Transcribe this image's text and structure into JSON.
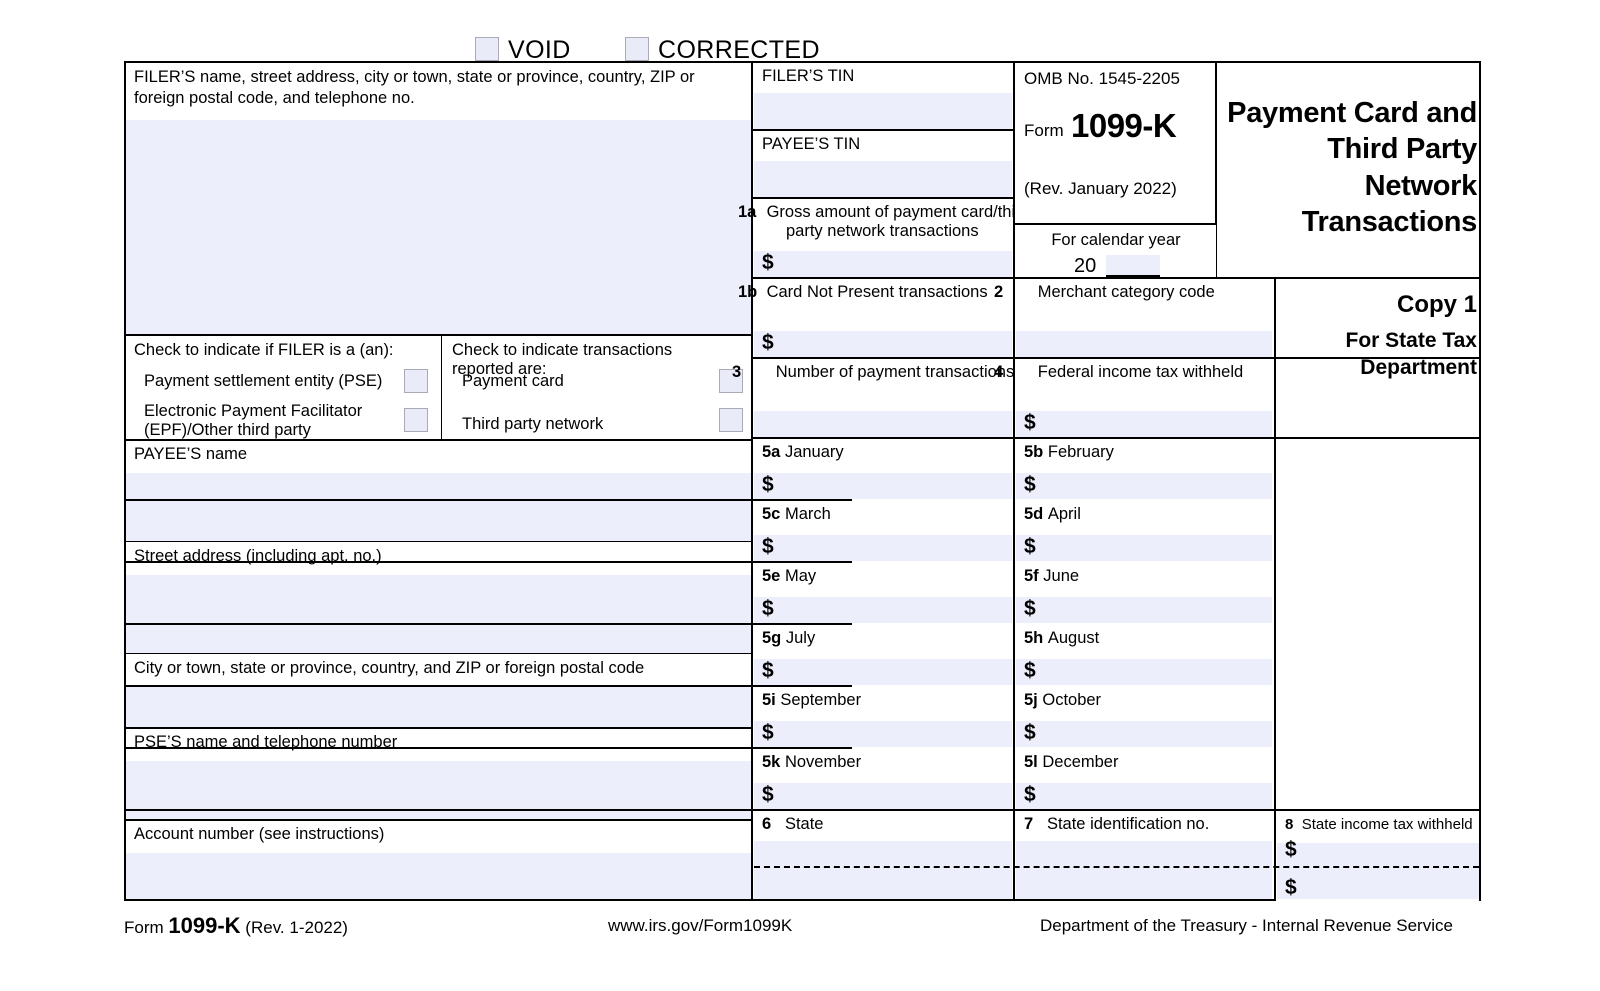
{
  "top_checkboxes": [
    {
      "name": "void",
      "label": "VOID",
      "checked": false
    },
    {
      "name": "corrected",
      "label": "CORRECTED",
      "checked": false
    }
  ],
  "filer": {
    "address_caption": "FILER’S name, street address, city or town, state or province, country, ZIP or foreign postal code, and telephone no.",
    "tin_caption": "FILER’S TIN",
    "tin_value": ""
  },
  "payee": {
    "tin_caption": "PAYEE’S TIN",
    "tin_value": "",
    "name_caption": "PAYEE’S name",
    "name_value": "",
    "street_caption": "Street address (including apt. no.)",
    "street_value": "",
    "city_caption": "City or town, state or province, country, and ZIP or foreign postal code",
    "city_value": ""
  },
  "pse": {
    "caption": "PSE’S name and telephone number",
    "value": ""
  },
  "account": {
    "caption": "Account number (see instructions)",
    "value": ""
  },
  "omb": {
    "number_label": "OMB No. 1545-2205",
    "form_word": "Form",
    "form_number": "1099-K",
    "revision": "(Rev. January 2022)",
    "calendar_year_label": "For calendar year",
    "year_prefix": "20",
    "year_value": ""
  },
  "title": {
    "line1": "Payment Card and",
    "line2": "Third Party",
    "line3": "Network",
    "line4": "Transactions"
  },
  "copy": {
    "line1": "Copy 1",
    "line2": "For State Tax",
    "line3": "Department"
  },
  "filer_type": {
    "heading": "Check to indicate if FILER is a (an):",
    "options": [
      {
        "label": "Payment settlement entity (PSE)",
        "checked": false
      },
      {
        "label": "Electronic Payment Facilitator (EPF)/Other third party",
        "checked": false
      }
    ]
  },
  "transaction_type": {
    "heading": "Check to indicate transactions reported are:",
    "options": [
      {
        "label": "Payment card",
        "checked": false
      },
      {
        "label": "Third party network",
        "checked": false
      }
    ]
  },
  "boxes": {
    "b1a": {
      "num": "1a",
      "label": "Gross amount of payment card/third party network transactions",
      "dollar": "$",
      "value": ""
    },
    "b1b": {
      "num": "1b",
      "label": "Card Not Present transactions",
      "dollar": "$",
      "value": ""
    },
    "b2": {
      "num": "2",
      "label": "Merchant category code",
      "dollar": "",
      "value": ""
    },
    "b3": {
      "num": "3",
      "label": "Number of payment transactions",
      "dollar": "",
      "value": ""
    },
    "b4": {
      "num": "4",
      "label": "Federal income tax withheld",
      "dollar": "$",
      "value": ""
    },
    "b6": {
      "num": "6",
      "label": "State",
      "dollar": "",
      "value": "",
      "value2": ""
    },
    "b7": {
      "num": "7",
      "label": "State identification no.",
      "dollar": "",
      "value": "",
      "value2": ""
    },
    "b8": {
      "num": "8",
      "label": "State income tax withheld",
      "dollar": "$",
      "value": "",
      "value2": ""
    }
  },
  "months": [
    {
      "num": "5a",
      "label": "January",
      "dollar": "$",
      "value": ""
    },
    {
      "num": "5b",
      "label": "February",
      "dollar": "$",
      "value": ""
    },
    {
      "num": "5c",
      "label": "March",
      "dollar": "$",
      "value": ""
    },
    {
      "num": "5d",
      "label": "April",
      "dollar": "$",
      "value": ""
    },
    {
      "num": "5e",
      "label": "May",
      "dollar": "$",
      "value": ""
    },
    {
      "num": "5f",
      "label": "June",
      "dollar": "$",
      "value": ""
    },
    {
      "num": "5g",
      "label": "July",
      "dollar": "$",
      "value": ""
    },
    {
      "num": "5h",
      "label": "August",
      "dollar": "$",
      "value": ""
    },
    {
      "num": "5i",
      "label": "September",
      "dollar": "$",
      "value": ""
    },
    {
      "num": "5j",
      "label": "October",
      "dollar": "$",
      "value": ""
    },
    {
      "num": "5k",
      "label": "November",
      "dollar": "$",
      "value": ""
    },
    {
      "num": "5l",
      "label": "December",
      "dollar": "$",
      "value": ""
    }
  ],
  "footer": {
    "form_word": "Form",
    "form_number": "1099-K",
    "revision": "(Rev. 1-2022)",
    "url": "www.irs.gov/Form1099K",
    "agency": "Department of the Treasury - Internal Revenue Service"
  },
  "colors": {
    "field_fill": "#edeefb",
    "checkbox_fill": "#e9ebf8",
    "checkbox_border": "#a9aab5",
    "rule": "#000000"
  }
}
